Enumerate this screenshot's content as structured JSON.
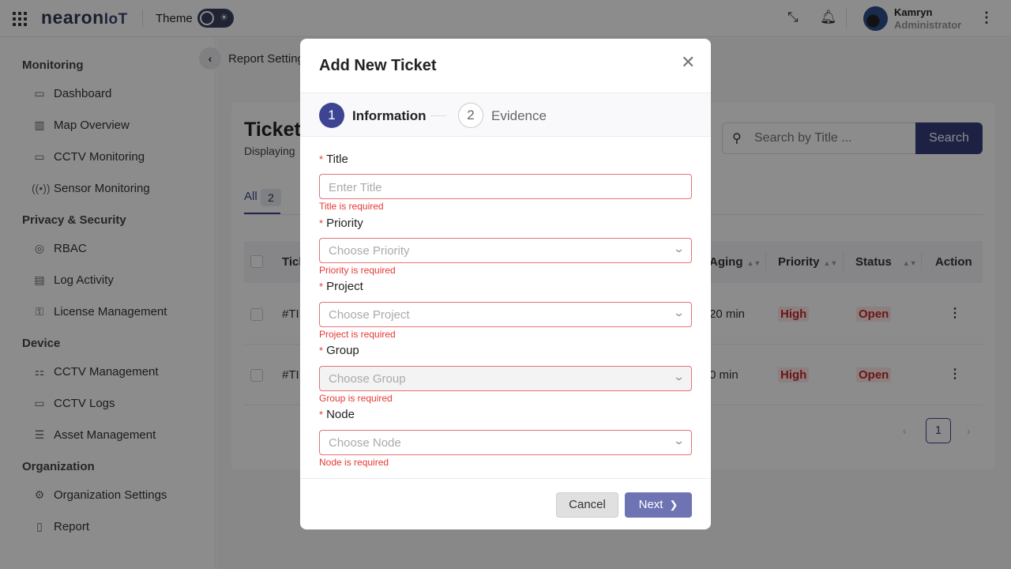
{
  "topbar": {
    "logo_main": "nearon",
    "logo_suffix": "IoT",
    "theme_label": "Theme",
    "user_name": "Kamryn",
    "user_role": "Administrator"
  },
  "sidebar": {
    "sections": {
      "monitoring": "Monitoring",
      "privacy": "Privacy & Security",
      "device": "Device",
      "organization": "Organization"
    },
    "items": {
      "dashboard": "Dashboard",
      "map_overview": "Map Overview",
      "cctv_monitoring": "CCTV Monitoring",
      "sensor_monitoring": "Sensor Monitoring",
      "rbac": "RBAC",
      "log_activity": "Log Activity",
      "license_management": "License Management",
      "cctv_management": "CCTV Management",
      "cctv_logs": "CCTV Logs",
      "asset_management": "Asset Management",
      "organization_settings": "Organization Settings",
      "report": "Report"
    }
  },
  "main": {
    "breadcrumb": "Report Setting",
    "title": "Ticketi",
    "subtitle": "Displaying",
    "search_placeholder": "Search by Title ...",
    "search_button": "Search",
    "tab_all": "All",
    "tab_count": "2",
    "columns": {
      "ticket": "Tick",
      "aging": "Aging",
      "priority": "Priority",
      "status": "Status",
      "action": "Action"
    },
    "rows": [
      {
        "id": "#TI",
        "aging": "20 min",
        "priority": "High",
        "status": "Open"
      },
      {
        "id": "#TI",
        "aging": "0 min",
        "priority": "High",
        "status": "Open"
      }
    ],
    "page": "1"
  },
  "modal": {
    "title": "Add New Ticket",
    "steps": [
      {
        "num": "1",
        "label": "Information"
      },
      {
        "num": "2",
        "label": "Evidence"
      }
    ],
    "fields": {
      "title": {
        "label": "Title",
        "placeholder": "Enter Title",
        "error": "Title is required"
      },
      "priority": {
        "label": "Priority",
        "placeholder": "Choose Priority",
        "error": "Priority is required"
      },
      "project": {
        "label": "Project",
        "placeholder": "Choose Project",
        "error": "Project is required"
      },
      "group": {
        "label": "Group",
        "placeholder": "Choose Group",
        "error": "Group is required"
      },
      "node": {
        "label": "Node",
        "placeholder": "Choose Node",
        "error": "Node is required"
      }
    },
    "required_mark": "*",
    "cancel": "Cancel",
    "next": "Next"
  }
}
